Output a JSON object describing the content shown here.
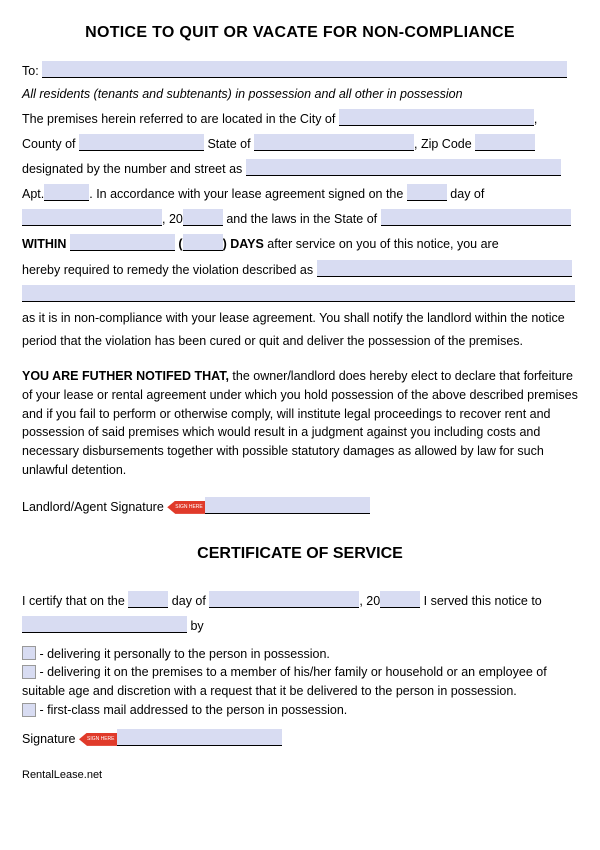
{
  "title": "NOTICE TO QUIT OR VACATE FOR NON-COMPLIANCE",
  "to_label": "To:",
  "residents_line": "All residents (tenants and subtenants) in possession and all other in possession",
  "t1": "The premises herein referred to are located in the City of ",
  "t2": "County of ",
  "t3": " State of ",
  "t4": ", Zip Code ",
  "t5": "designated by the number and street as ",
  "t6": "Apt.",
  "t7": ". In accordance with your lease agreement signed on the ",
  "t8": " day of",
  "t9": ", 20",
  "t10": " and the laws in the State of ",
  "within": "WITHIN",
  "days_after": "DAYS",
  "t11": " after service on you of this notice, you are",
  "t12": "hereby required to remedy the violation described as ",
  "t13": "as it is in non-compliance with your lease agreement. You shall notify the landlord within the notice period that the violation has been cured or quit and deliver the possession of the premises.",
  "further_bold": "YOU ARE FUTHER NOTIFED THAT,",
  "further_text": " the owner/landlord does hereby elect to declare that forfeiture of your lease or rental agreement under which you hold possession of the above described premises and if you fail to perform or otherwise comply, will institute legal proceedings to recover rent and possession of said premises which would result in a judgment against you including costs and necessary disbursements together with possible statutory damages as allowed by law for such unlawful detention.",
  "landlord_sig": "Landlord/Agent Signature ",
  "cert_title": "CERTIFICATE OF SERVICE",
  "c1": "I certify that on the ",
  "c2": " day of ",
  "c3": ", 20",
  "c4": " I served this notice to",
  "c5": " by",
  "opt1": " - delivering it personally to the person in possession.",
  "opt2": " - delivering it on the premises to a member of his/her family or household or an employee of suitable age and discretion with a request that it be delivered to the person in possession.",
  "opt3": " - first-class mail addressed to the person in possession.",
  "sig2": "Signature ",
  "sign_here": "SIGN HERE",
  "footer": "RentalLease.net"
}
